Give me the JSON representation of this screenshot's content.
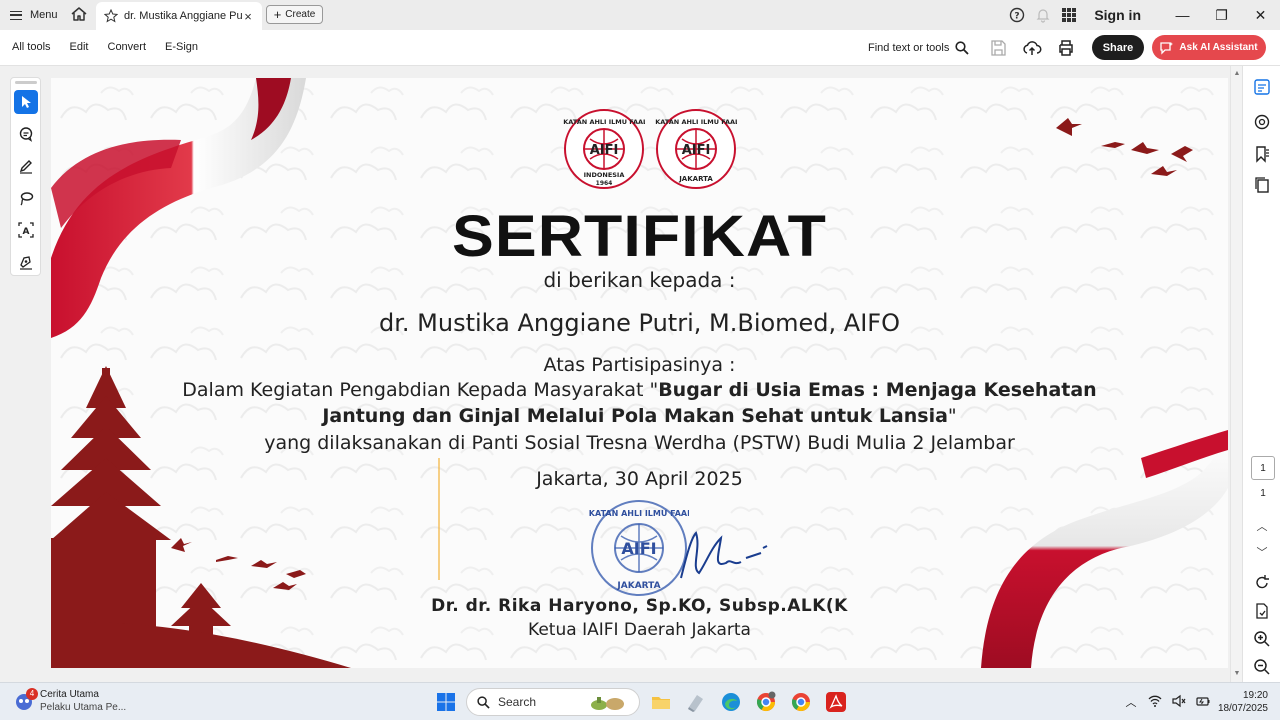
{
  "titlebar": {
    "menu_label": "Menu",
    "tab_title": "dr. Mustika Anggiane Pu...",
    "tab_close": "×",
    "create_label": "Create",
    "signin_label": "Sign in",
    "window_controls": [
      "—",
      "❐",
      "✕"
    ]
  },
  "toolbar": {
    "menu_items": [
      "All tools",
      "Edit",
      "Convert",
      "E-Sign"
    ],
    "find_label": "Find text or tools",
    "share_label": "Share",
    "ai_label": "Ask AI Assistant"
  },
  "colors": {
    "accent_blue": "#1473e6",
    "ai_red": "#e5484d",
    "certificate_red": "#8b1a1a",
    "ribbon_red": "#c8102e"
  },
  "certificate": {
    "logo1_top_text": "IKATAN AHLI ILMU FAAL",
    "logo1_mark": "AIFI",
    "logo1_bottom_text": "INDONESIA",
    "logo1_year": "1964",
    "logo2_bottom_text": "JAKARTA",
    "title": "SERTIFIKAT",
    "given_to": "di berikan kepada :",
    "recipient": "dr. Mustika Anggiane Putri, M.Biomed, AIFO",
    "for_participation": "Atas Partisipasinya :",
    "line1_prefix": "Dalam Kegiatan Pengabdian Kepada Masyarakat \"",
    "line1_bold": "Bugar di Usia Emas : Menjaga Kesehatan",
    "line2_bold": "Jantung dan Ginjal Melalui Pola Makan Sehat untuk Lansia",
    "line2_suffix": "\"",
    "line3": "yang dilaksanakan di Panti Sosial Tresna Werdha (PSTW) Budi Mulia 2 Jelambar",
    "date": "Jakarta, 30 April 2025",
    "signer": "Dr. dr. Rika Haryono, Sp.KO, Subsp.ALK(K",
    "signer_role": "Ketua IAIFI Daerah Jakarta"
  },
  "pagenav": {
    "current_page": "1",
    "total_pages": "1"
  },
  "taskbar": {
    "news_badge": "4",
    "news_title": "Cerita Utama",
    "news_subtitle": "Pelaku Utama Pe...",
    "search_label": "Search",
    "time": "19:20",
    "date": "18/07/2025"
  }
}
